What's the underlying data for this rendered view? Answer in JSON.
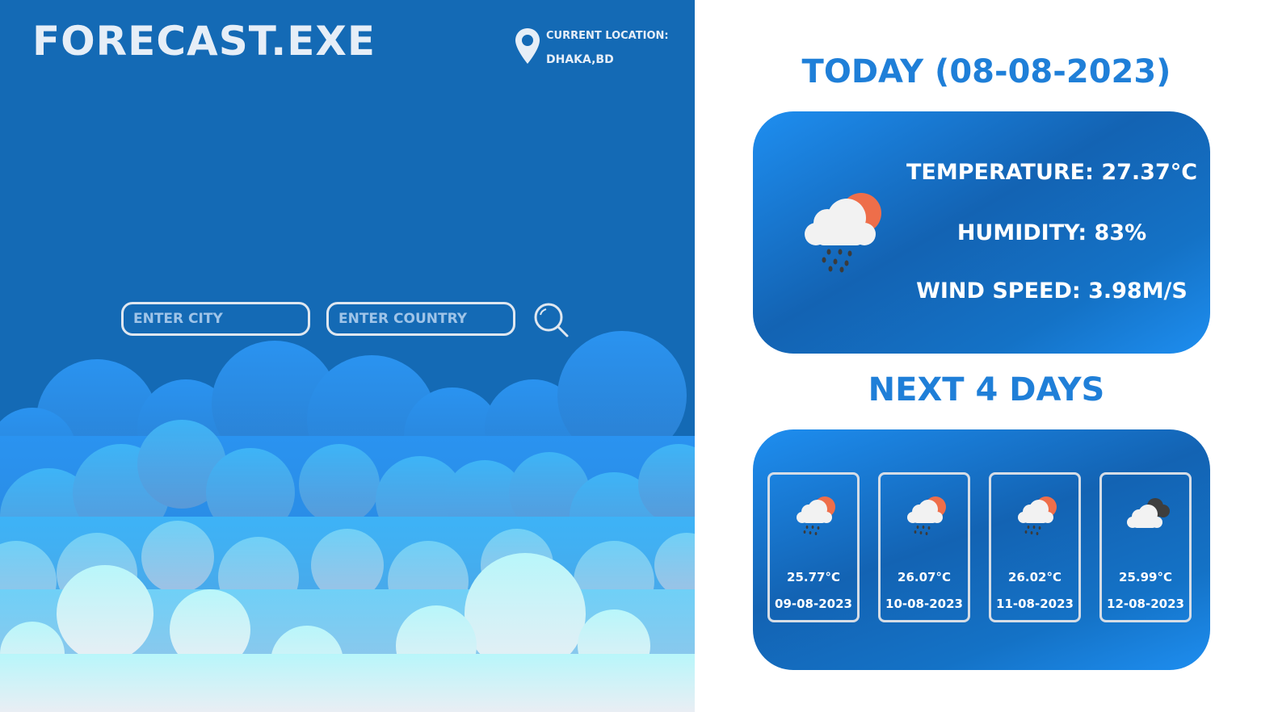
{
  "app": {
    "title": "FORECAST.EXE"
  },
  "location": {
    "label": "CURRENT LOCATION:",
    "value": "DHAKA,BD"
  },
  "search": {
    "city_placeholder": "ENTER CITY",
    "country_placeholder": "ENTER COUNTRY",
    "icon": "search-icon"
  },
  "today": {
    "heading": "TODAY (08-08-2023)",
    "icon": "rain-cloud-sun-icon",
    "temperature": "TEMPERATURE: 27.37°C",
    "humidity": "HUMIDITY: 83%",
    "wind_speed": "WIND SPEED: 3.98M/S"
  },
  "forecast": {
    "heading": "NEXT 4 DAYS",
    "days": [
      {
        "temp": "25.77°C",
        "date": "09-08-2023",
        "icon": "rain-cloud-sun-icon"
      },
      {
        "temp": "26.07°C",
        "date": "10-08-2023",
        "icon": "rain-cloud-sun-icon"
      },
      {
        "temp": "26.02°C",
        "date": "11-08-2023",
        "icon": "rain-cloud-sun-icon"
      },
      {
        "temp": "25.99°C",
        "date": "12-08-2023",
        "icon": "overcast-clouds-icon"
      }
    ]
  },
  "colors": {
    "panel_bg": "#146ab5",
    "accent": "#1f7fd8",
    "sun": "#ee6e4a",
    "cloud": "#f2f2f2"
  }
}
